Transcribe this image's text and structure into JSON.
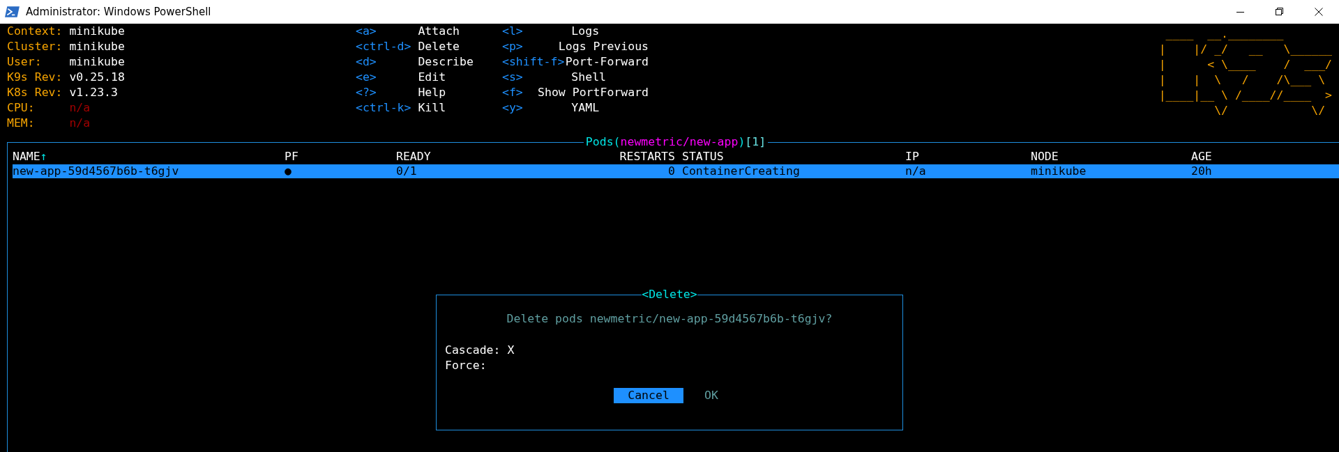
{
  "window": {
    "title": "Administrator: Windows PowerShell"
  },
  "cluster_info": [
    {
      "label": "Context:",
      "value": "minikube",
      "kind": "normal"
    },
    {
      "label": "Cluster:",
      "value": "minikube",
      "kind": "normal"
    },
    {
      "label": "User:",
      "value": "minikube",
      "kind": "normal"
    },
    {
      "label": "K9s Rev:",
      "value": "v0.25.18",
      "kind": "normal"
    },
    {
      "label": "K8s Rev:",
      "value": "v1.23.3",
      "kind": "normal"
    },
    {
      "label": "CPU:",
      "value": "n/a",
      "kind": "unavailable"
    },
    {
      "label": "MEM:",
      "value": "n/a",
      "kind": "unavailable"
    }
  ],
  "key_hint_columns": [
    {
      "hints": [
        {
          "key": "<a>",
          "action": "Attach"
        },
        {
          "key": "<ctrl-d>",
          "action": "Delete"
        },
        {
          "key": "<d>",
          "action": "Describe"
        },
        {
          "key": "<e>",
          "action": "Edit"
        },
        {
          "key": "<?>",
          "action": "Help"
        },
        {
          "key": "<ctrl-k>",
          "action": "Kill"
        }
      ]
    },
    {
      "hints": [
        {
          "key": "<l>",
          "action": "Logs"
        },
        {
          "key": "<p>",
          "action": "Logs Previous"
        },
        {
          "key": "<shift-f>",
          "action": "Port-Forward"
        },
        {
          "key": "<s>",
          "action": "Shell"
        },
        {
          "key": "<f>",
          "action": "Show PortForward"
        },
        {
          "key": "<y>",
          "action": "YAML"
        }
      ]
    }
  ],
  "logo": {
    "lines": [
      " ____  __.________",
      "|    |/ _/   __   \\______",
      "|      < \\____    /  ___/",
      "|    |  \\   /    /\\___ \\",
      "|____|__ \\ /____//____  >",
      "        \\/            \\/"
    ]
  },
  "pods": {
    "title_parts": [
      {
        "text": "Pods(",
        "kind": "plain"
      },
      {
        "text": "newmetric/new-app",
        "kind": "namespace"
      },
      {
        "text": ")",
        "kind": "plain"
      },
      {
        "text": "[1]",
        "kind": "count"
      }
    ],
    "columns": [
      {
        "label": "NAME",
        "sort_mark": "↑",
        "kind": "text"
      },
      {
        "label": "PF",
        "kind": "text"
      },
      {
        "label": "READY",
        "kind": "text"
      },
      {
        "label": "RESTARTS",
        "kind": "number"
      },
      {
        "label": "STATUS",
        "kind": "text"
      },
      {
        "label": "IP",
        "kind": "text"
      },
      {
        "label": "NODE",
        "kind": "text"
      },
      {
        "label": "AGE",
        "kind": "text"
      }
    ],
    "rows": [
      {
        "selected": true,
        "cells": [
          "new-app-59d4567b6b-t6gjv",
          "●",
          "0/1",
          "0",
          "ContainerCreating",
          "n/a",
          "minikube",
          "20h"
        ]
      }
    ]
  },
  "dialog": {
    "title": "<Delete>",
    "message": "Delete pods newmetric/new-app-59d4567b6b-t6gjv?",
    "check_mark": "X",
    "options": [
      {
        "label": "Cascade:",
        "checked": true
      },
      {
        "label": "Force:",
        "checked": false
      }
    ],
    "buttons": [
      {
        "label": "Cancel",
        "selected": true
      },
      {
        "label": "OK",
        "selected": false
      }
    ]
  }
}
